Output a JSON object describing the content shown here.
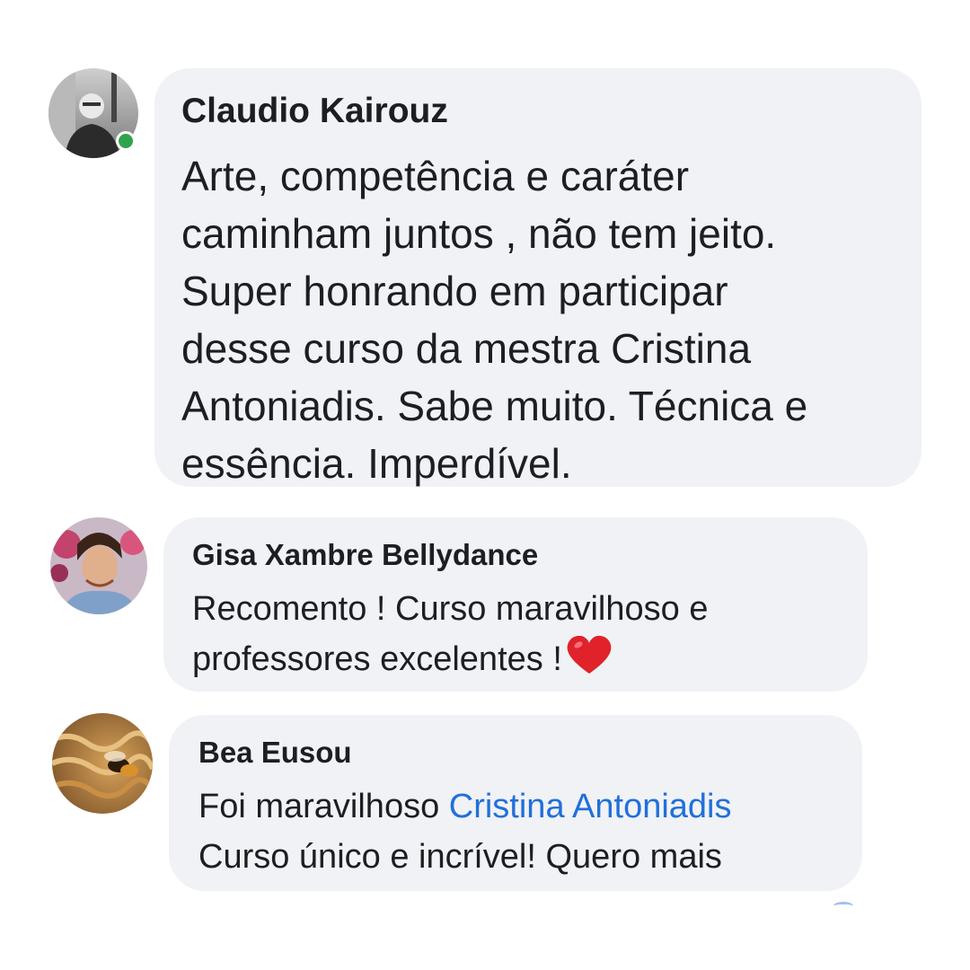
{
  "comments": [
    {
      "author": "Claudio Kairouz",
      "lines": [
        "Arte, competência e caráter",
        "caminham juntos , não tem jeito.",
        "Super honrando em participar",
        "desse curso da mestra Cristina",
        "Antoniadis. Sabe muito. Técnica e",
        "essência. Imperdível."
      ],
      "online": true
    },
    {
      "author": "Gisa Xambre Bellydance",
      "line1": "Recomento ! Curso maravilhoso e",
      "line2": "professores excelentes !",
      "emoji_icon": "red-heart-icon"
    },
    {
      "author": "Bea Eusou",
      "line1_prefix": "Foi maravilhoso ",
      "mention": "Cristina Antoniadis",
      "line2": "Curso único e incrível! Quero mais"
    }
  ],
  "colors": {
    "bubble": "#f0f2f5",
    "online": "#31a24c",
    "mention": "#216fdb",
    "heart": "#e0222b"
  }
}
